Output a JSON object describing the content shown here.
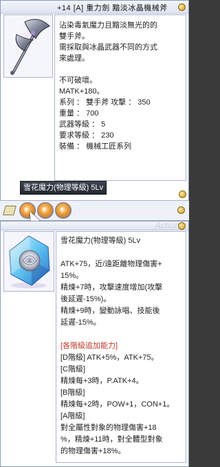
{
  "item_window": {
    "title": "+14 [A] 重力劍 黯淡冰晶機械斧",
    "description": [
      "沾染毒氣魔力且黯淡無光的的",
      "雙手斧。",
      "需採取與冰晶武器不同的方式",
      "來處理。",
      "",
      "不可破壞。",
      "MATK+180。",
      "系列 ： 雙手斧 攻擊 ： 350",
      "重量 ： 700",
      "武器等級 ： 5",
      "要求等級 ： 230",
      "裝備 ： 機械工匠系列"
    ],
    "card_tab_label": "雪花魔力(物理等級) 5Lv"
  },
  "card_window": {
    "watermark": "Actions",
    "description": [
      {
        "text": "雪花魔力(物理等級) 5Lv",
        "color": "#222222"
      },
      {
        "text": "",
        "color": "#222222"
      },
      {
        "text": "ATK+75，近/遠距離物理傷害+",
        "color": "#222222"
      },
      {
        "text": "15%。",
        "color": "#222222"
      },
      {
        "text": "精煉+7時，攻擊速度增加(攻擊",
        "color": "#222222"
      },
      {
        "text": "後延遲-15%)。",
        "color": "#222222"
      },
      {
        "text": "精煉+9時，變動詠唱、技能後",
        "color": "#222222"
      },
      {
        "text": "延遲-15%。",
        "color": "#222222"
      },
      {
        "text": "",
        "color": "#222222"
      },
      {
        "text": "[各階級追加能力]",
        "color": "#c0392b"
      },
      {
        "text": "[D階級] ATK+5%，ATK+75。",
        "color": "#222222"
      },
      {
        "text": "[C階級]",
        "color": "#222222"
      },
      {
        "text": "  精煉每+3時，P.ATK+4。",
        "color": "#222222"
      },
      {
        "text": "[B階級]",
        "color": "#222222"
      },
      {
        "text": "  精煉每+2時，POW+1，CON+1。",
        "color": "#222222"
      },
      {
        "text": "[A階級]",
        "color": "#222222"
      },
      {
        "text": "  對全屬性對象的物理傷害+18",
        "color": "#222222"
      },
      {
        "text": "%，精煉+11時，對全體型對象",
        "color": "#222222"
      },
      {
        "text": "的物理傷害+18%。",
        "color": "#222222"
      }
    ]
  },
  "icons": [
    "close-icon",
    "axe-icon",
    "card-icon",
    "slot-gem-icon",
    "crystal-rose-icon",
    "cursor-icon"
  ],
  "colors": {
    "accent": "#8a9ab8",
    "title_bg": "#dfe5f1",
    "tab_bg": "#232830",
    "red": "#c0392b"
  }
}
